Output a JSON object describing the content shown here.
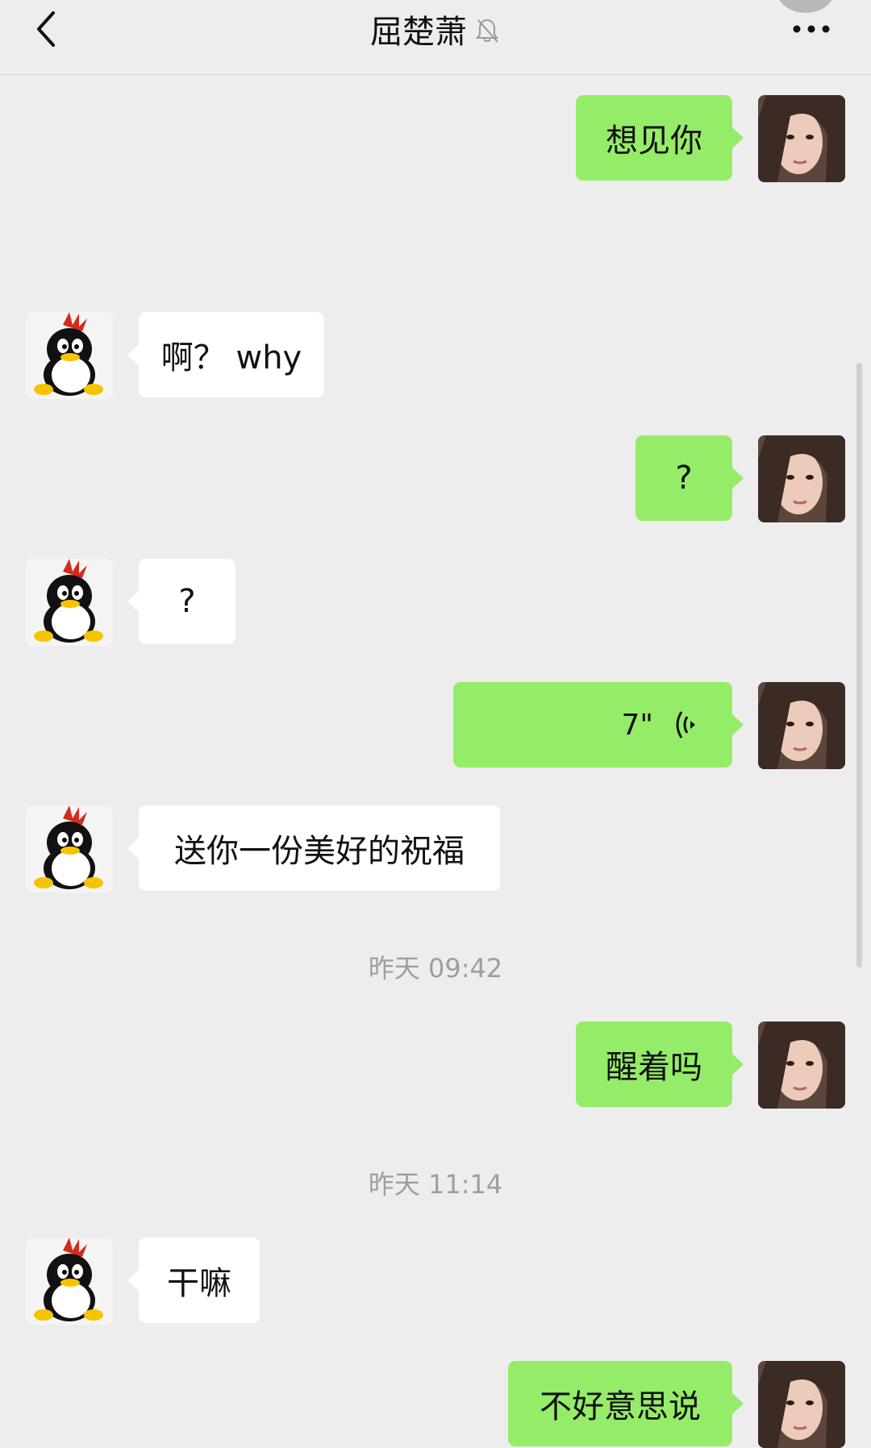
{
  "header": {
    "title": "屈楚萧",
    "back_icon": "chevron-left-icon",
    "mute_icon": "bell-muted-icon",
    "more_icon": "more-horizontal-icon"
  },
  "messages": [
    {
      "side": "right",
      "text": "想见你"
    },
    {
      "side": "left",
      "text": "啊？ why"
    },
    {
      "side": "right",
      "text": "?"
    },
    {
      "side": "left",
      "text": "?"
    },
    {
      "side": "right",
      "type": "voice",
      "duration": "7\""
    },
    {
      "side": "left",
      "text": "送你一份美好的祝福"
    },
    {
      "type": "time",
      "text": "昨天 09:42"
    },
    {
      "side": "right",
      "text": "醒着吗"
    },
    {
      "type": "time",
      "text": "昨天 11:14"
    },
    {
      "side": "left",
      "text": "干嘛"
    },
    {
      "side": "right",
      "text": "不好意思说"
    }
  ],
  "colors": {
    "background": "#ededed",
    "sent_bubble": "#95ec69",
    "received_bubble": "#ffffff",
    "timestamp": "#9e9e9e"
  }
}
